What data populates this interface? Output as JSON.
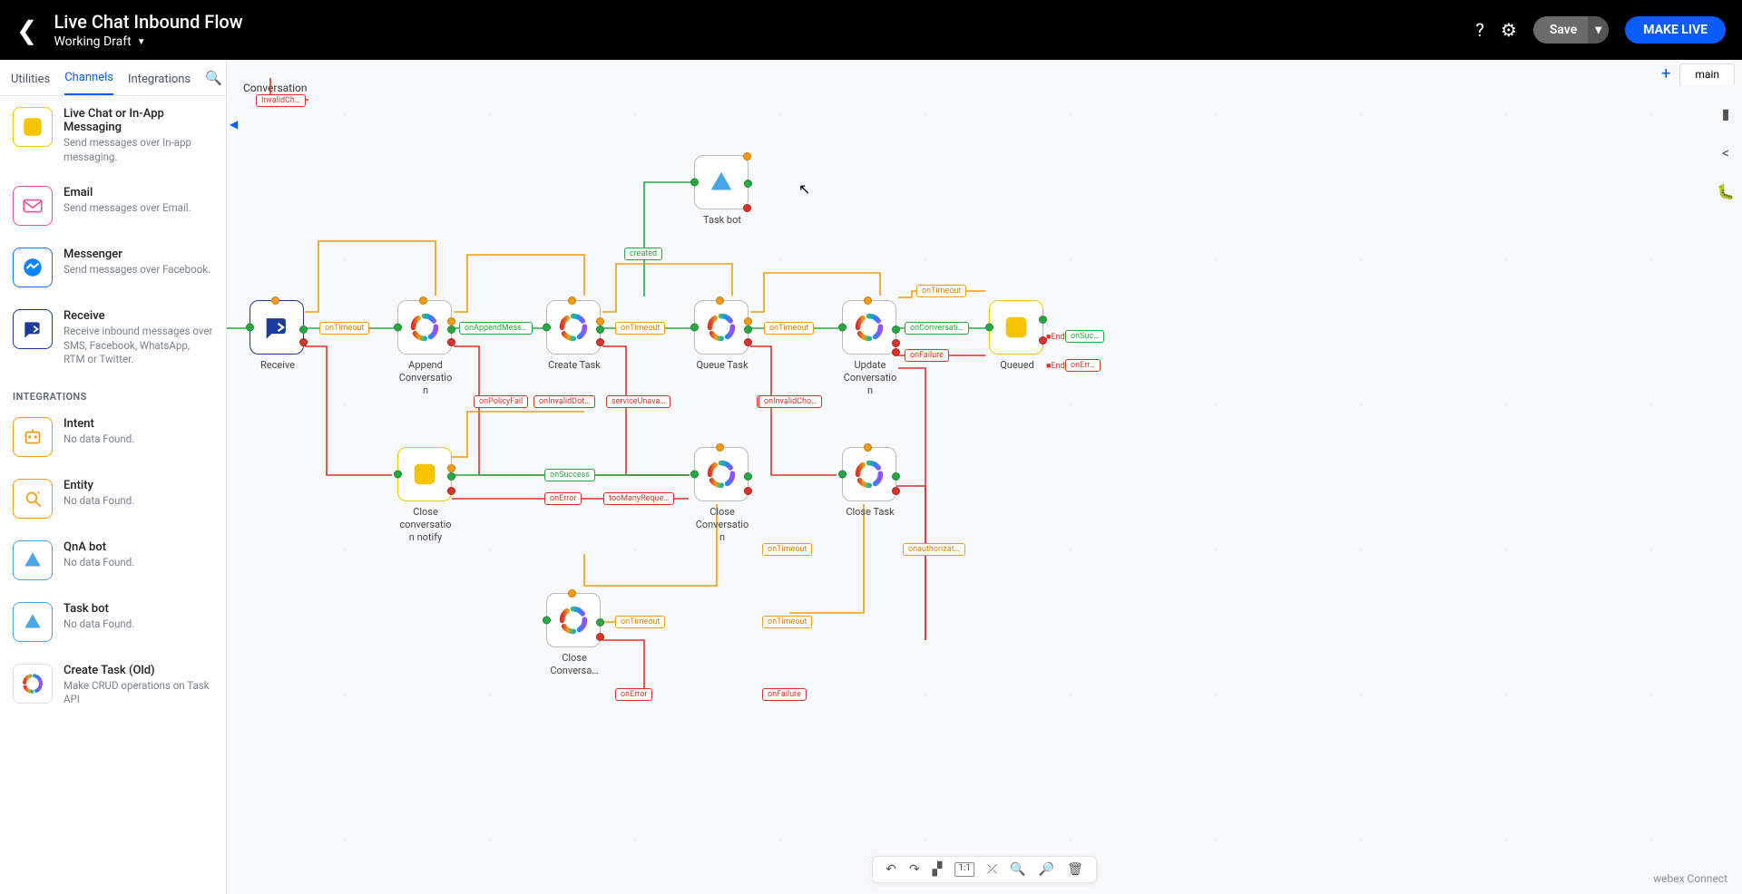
{
  "header": {
    "title": "Live Chat Inbound Flow",
    "status": "Working Draft",
    "save": "Save",
    "live": "MAKE LIVE"
  },
  "sidebar": {
    "tabs": [
      "Utilities",
      "Channels",
      "Integrations"
    ],
    "active": 1,
    "section_integrations": "INTEGRATIONS",
    "items": [
      {
        "name": "Live Chat or In-App Messaging",
        "desc": "Send messages over In-app messaging.",
        "icon": "chat-yellow"
      },
      {
        "name": "Email",
        "desc": "Send messages over Email.",
        "icon": "email-pink"
      },
      {
        "name": "Messenger",
        "desc": "Send messages over Facebook.",
        "icon": "messenger-blue"
      },
      {
        "name": "Receive",
        "desc": "Receive inbound messages over SMS, Facebook, WhatsApp, RTM or Twitter.",
        "icon": "receive-blue"
      }
    ],
    "integrations": [
      {
        "name": "Intent",
        "desc": "No data Found.",
        "icon": "intent"
      },
      {
        "name": "Entity",
        "desc": "No data Found.",
        "icon": "entity"
      },
      {
        "name": "QnA bot",
        "desc": "No data Found.",
        "icon": "qna"
      },
      {
        "name": "Task bot",
        "desc": "No data Found.",
        "icon": "taskbot"
      },
      {
        "name": "Create Task (Old)",
        "desc": "Make CRUD operations on Task API",
        "icon": "task-c"
      }
    ]
  },
  "canvas": {
    "main_tab": "main",
    "conv_hint": "Conversation",
    "nodes": {
      "receive": {
        "label": "Receive"
      },
      "appendc": {
        "label": "Append Conversation"
      },
      "createt": {
        "label": "Create Task"
      },
      "queuet": {
        "label": "Queue Task"
      },
      "updatec": {
        "label": "Update Conversation"
      },
      "queued": {
        "label": "Queued"
      },
      "taskbot": {
        "label": "Task bot"
      },
      "closenot": {
        "label": "Close conversation notify"
      },
      "closeconv": {
        "label": "Close Conversation"
      },
      "closetask": {
        "label": "Close Task"
      },
      "closeconv2": {
        "label": "Close Conversa…"
      }
    },
    "pills": {
      "onTimeout": "onTimeout",
      "onAppend": "onAppendMess…",
      "created": "created",
      "onConv": "onConversati…",
      "onFailure": "onFailure",
      "onSuccess": "onSuccess",
      "onError": "onError",
      "onPolicyFail": "onPolicyFail",
      "onInvalidDot": "onInvalidDot…",
      "serviceUnava": "serviceUnava…",
      "onInvalidCho": "onInvalidCho…",
      "tooManyReque": "tooManyReque…",
      "onauthorizat": "onauthorizat…",
      "onFailureB": "onFailure",
      "InvalidCh": "InvalidCh…",
      "End": "End",
      "onSuc": "onSuc…",
      "onErr": "onErr…"
    },
    "toolbar_icons": [
      "undo",
      "redo",
      "snap",
      "fit",
      "center",
      "zoom-out",
      "zoom-in",
      "trash"
    ],
    "brand": "webex Connect"
  }
}
